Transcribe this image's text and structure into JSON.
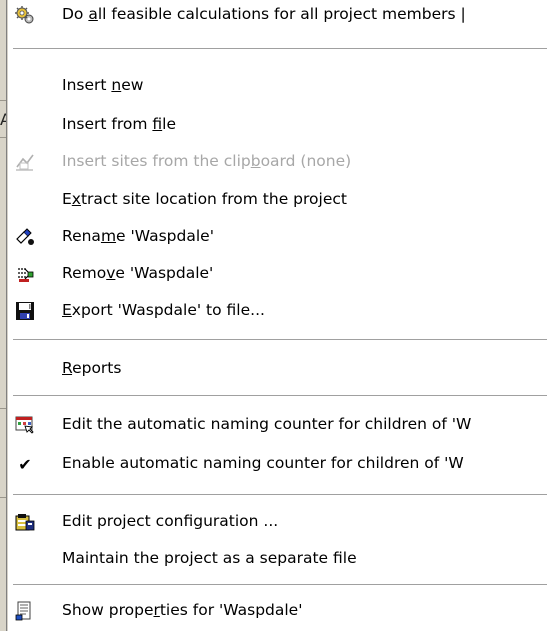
{
  "menu": {
    "items": [
      {
        "name": "do-all-calculations",
        "label_pre": "Do ",
        "mnemonic": "a",
        "label_post": "ll feasible calculations for all project members |",
        "icon": "gears-icon",
        "disabled": false
      },
      {
        "name": "insert-new",
        "label_pre": "Insert ",
        "mnemonic": "n",
        "label_post": "ew",
        "icon": "",
        "disabled": false
      },
      {
        "name": "insert-from-file",
        "label_pre": "Insert from ",
        "mnemonic": "f",
        "label_post": "ile",
        "icon": "",
        "disabled": false
      },
      {
        "name": "insert-sites-clipboard",
        "label_pre": "Insert sites from the clip",
        "mnemonic": "b",
        "label_post": "oard (none)",
        "icon": "clipboard-sites-icon",
        "disabled": true
      },
      {
        "name": "extract-site-location",
        "label_pre": "E",
        "mnemonic": "x",
        "label_post": "tract site location from the project",
        "icon": "",
        "disabled": false
      },
      {
        "name": "rename",
        "label_pre": "Rena",
        "mnemonic": "m",
        "label_post": "e 'Waspdale'",
        "icon": "rename-icon",
        "disabled": false
      },
      {
        "name": "remove",
        "label_pre": "Remo",
        "mnemonic": "v",
        "label_post": "e 'Waspdale'",
        "icon": "remove-icon",
        "disabled": false
      },
      {
        "name": "export-to-file",
        "label_pre": "",
        "mnemonic": "E",
        "label_post": "xport 'Waspdale' to file...",
        "icon": "floppy-disk-icon",
        "disabled": false
      },
      {
        "name": "reports",
        "label_pre": "",
        "mnemonic": "R",
        "label_post": "eports",
        "icon": "",
        "disabled": false
      },
      {
        "name": "edit-naming-counter",
        "label_pre": "Edit the automatic naming counter for children of 'W",
        "mnemonic": "",
        "label_post": "",
        "icon": "counter-edit-icon",
        "disabled": false
      },
      {
        "name": "enable-naming-counter",
        "label_pre": "Enable automatic naming counter for children of 'W",
        "mnemonic": "",
        "label_post": "",
        "icon": "checkmark-icon",
        "disabled": false
      },
      {
        "name": "edit-project-configuration",
        "label_pre": "Edit project configuration ...",
        "mnemonic": "",
        "label_post": "",
        "icon": "project-config-icon",
        "disabled": false
      },
      {
        "name": "maintain-separate-file",
        "label_pre": "Maintain the project as a separate file",
        "mnemonic": "",
        "label_post": "",
        "icon": "",
        "disabled": false
      },
      {
        "name": "show-properties",
        "label_pre": "Show prope",
        "mnemonic": "r",
        "label_post": "ties for 'Waspdale'",
        "icon": "properties-icon",
        "disabled": false
      }
    ]
  },
  "background": {
    "partial_char": "A"
  }
}
